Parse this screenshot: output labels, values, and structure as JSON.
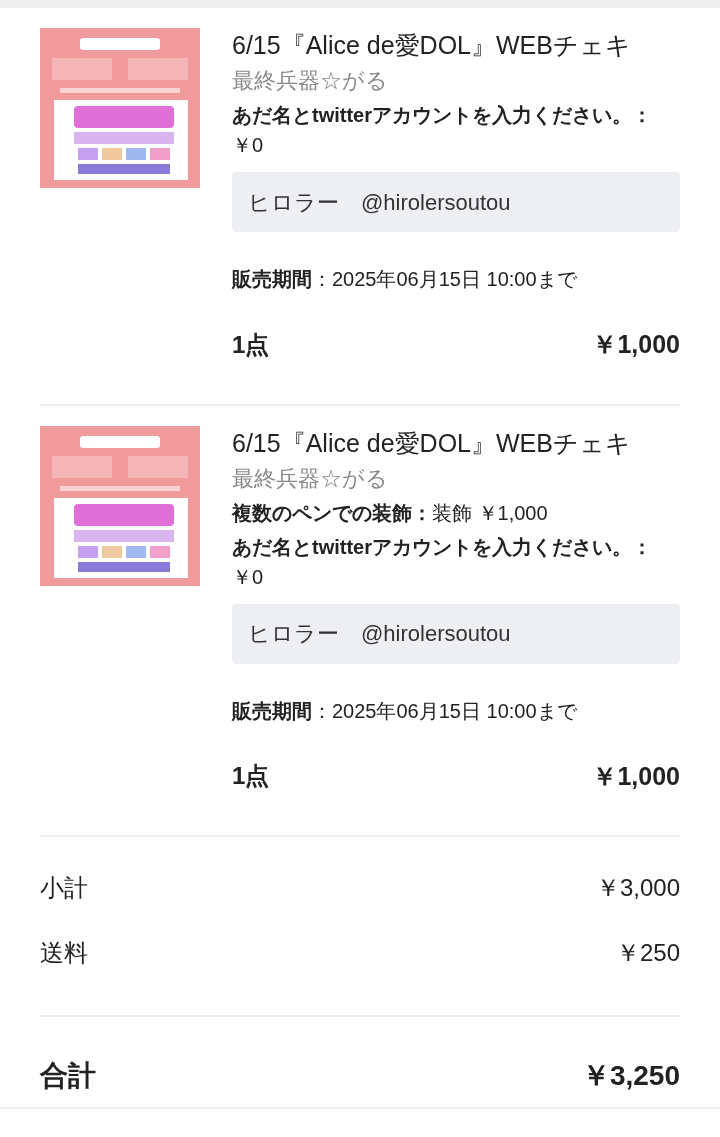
{
  "items": [
    {
      "kind": "picture",
      "title": "6/15『Alice de愛DOL』WEBチェキ",
      "seller": "最終兵器☆がる",
      "options": [
        "**あだ名とtwitterアカウントを入力ください。：**￥0"
      ],
      "note": "ヒロラー　@hirolersoutou",
      "sale_period": "**販売期間**：2025年06月15日 10:00まで",
      "quantity": "1点",
      "price": "￥1,000"
    },
    {
      "kind": "picture",
      "title": "6/15『Alice de愛DOL』WEBチェキ",
      "seller": "最終兵器☆がる",
      "options": [
        "**複数のペンでの装飾：**装飾 ￥1,000",
        "**あだ名とtwitterアカウントを入力ください。：**￥0"
      ],
      "note": "ヒロラー　@hirolersoutou",
      "sale_period": "**販売期間**：2025年06月15日 10:00まで",
      "quantity": "1点",
      "price": "￥1,000"
    }
  ],
  "summary": [
    {
      "label": "小計",
      "value": "￥3,000"
    },
    {
      "label": "送料",
      "value": "￥250"
    }
  ],
  "total": {
    "label": "合計",
    "value": "￥3,250"
  }
}
